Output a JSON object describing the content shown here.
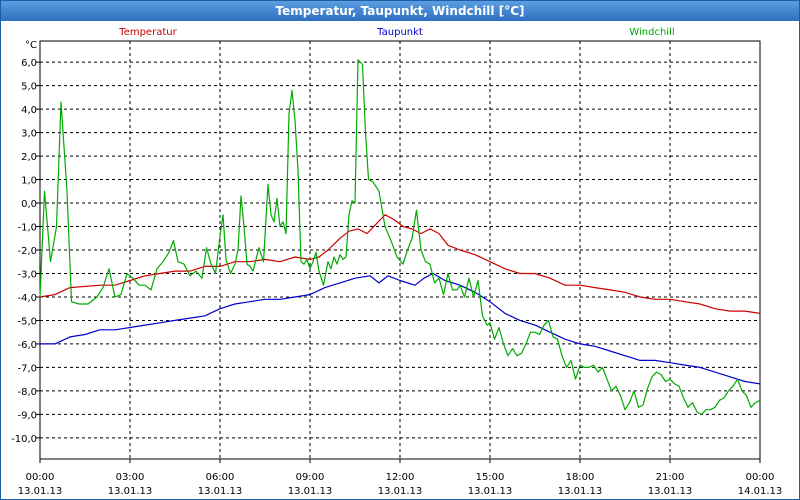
{
  "window": {
    "title": "Temperatur, Taupunkt, Windchill [°C]"
  },
  "chart_data": {
    "type": "line",
    "title": "Temperatur, Taupunkt, Windchill [°C]",
    "ylabel": "°C",
    "xlim": [
      0,
      24
    ],
    "ylim": [
      -10.9,
      6.9
    ],
    "grid": true,
    "legend": "top",
    "y_ticks": [
      "6,0",
      "5,0",
      "4,0",
      "3,0",
      "2,0",
      "1,0",
      "0,0",
      "-1,0",
      "-2,0",
      "-3,0",
      "-4,0",
      "-5,0",
      "-6,0",
      "-7,0",
      "-8,0",
      "-9,0",
      "-10,0"
    ],
    "x_ticks": [
      {
        "time": "00:00",
        "date": "13.01.13"
      },
      {
        "time": "03:00",
        "date": "13.01.13"
      },
      {
        "time": "06:00",
        "date": "13.01.13"
      },
      {
        "time": "09:00",
        "date": "13.01.13"
      },
      {
        "time": "12:00",
        "date": "13.01.13"
      },
      {
        "time": "15:00",
        "date": "13.01.13"
      },
      {
        "time": "18:00",
        "date": "13.01.13"
      },
      {
        "time": "21:00",
        "date": "13.01.13"
      },
      {
        "time": "00:00",
        "date": "14.01.13"
      }
    ],
    "series": [
      {
        "name": "Temperatur",
        "color": "#cc0000",
        "points": [
          [
            0,
            -4.0
          ],
          [
            0.5,
            -3.9
          ],
          [
            1,
            -3.6
          ],
          [
            2,
            -3.5
          ],
          [
            2.5,
            -3.5
          ],
          [
            3,
            -3.3
          ],
          [
            3.5,
            -3.1
          ],
          [
            4,
            -3.0
          ],
          [
            4.5,
            -2.9
          ],
          [
            5,
            -2.9
          ],
          [
            5.5,
            -2.7
          ],
          [
            6,
            -2.7
          ],
          [
            6.5,
            -2.5
          ],
          [
            7,
            -2.5
          ],
          [
            7.5,
            -2.4
          ],
          [
            8,
            -2.5
          ],
          [
            8.5,
            -2.3
          ],
          [
            9,
            -2.4
          ],
          [
            9.3,
            -2.3
          ],
          [
            9.6,
            -2.0
          ],
          [
            10,
            -1.5
          ],
          [
            10.3,
            -1.2
          ],
          [
            10.6,
            -1.1
          ],
          [
            10.9,
            -1.3
          ],
          [
            11.2,
            -0.9
          ],
          [
            11.5,
            -0.5
          ],
          [
            11.8,
            -0.7
          ],
          [
            12.1,
            -1.0
          ],
          [
            12.4,
            -1.1
          ],
          [
            12.7,
            -1.3
          ],
          [
            13,
            -1.1
          ],
          [
            13.3,
            -1.3
          ],
          [
            13.6,
            -1.8
          ],
          [
            14,
            -2.0
          ],
          [
            14.5,
            -2.2
          ],
          [
            15,
            -2.5
          ],
          [
            15.5,
            -2.8
          ],
          [
            16,
            -3.0
          ],
          [
            16.5,
            -3.0
          ],
          [
            17,
            -3.2
          ],
          [
            17.5,
            -3.5
          ],
          [
            18,
            -3.5
          ],
          [
            18.5,
            -3.6
          ],
          [
            19,
            -3.7
          ],
          [
            19.5,
            -3.8
          ],
          [
            20,
            -4.0
          ],
          [
            20.5,
            -4.1
          ],
          [
            21,
            -4.1
          ],
          [
            21.5,
            -4.2
          ],
          [
            22,
            -4.3
          ],
          [
            22.5,
            -4.5
          ],
          [
            23,
            -4.6
          ],
          [
            23.5,
            -4.6
          ],
          [
            24,
            -4.7
          ]
        ]
      },
      {
        "name": "Taupunkt",
        "color": "#0000cc",
        "points": [
          [
            0,
            -6.0
          ],
          [
            0.5,
            -6.0
          ],
          [
            1,
            -5.7
          ],
          [
            1.5,
            -5.6
          ],
          [
            2,
            -5.4
          ],
          [
            2.5,
            -5.4
          ],
          [
            3,
            -5.3
          ],
          [
            3.5,
            -5.2
          ],
          [
            4,
            -5.1
          ],
          [
            4.5,
            -5.0
          ],
          [
            5,
            -4.9
          ],
          [
            5.5,
            -4.8
          ],
          [
            6,
            -4.5
          ],
          [
            6.5,
            -4.3
          ],
          [
            7,
            -4.2
          ],
          [
            7.5,
            -4.1
          ],
          [
            8,
            -4.1
          ],
          [
            8.5,
            -4.0
          ],
          [
            9,
            -3.9
          ],
          [
            9.5,
            -3.6
          ],
          [
            10,
            -3.4
          ],
          [
            10.5,
            -3.2
          ],
          [
            11,
            -3.1
          ],
          [
            11.3,
            -3.4
          ],
          [
            11.6,
            -3.1
          ],
          [
            12,
            -3.3
          ],
          [
            12.5,
            -3.5
          ],
          [
            12.8,
            -3.2
          ],
          [
            13.1,
            -3.0
          ],
          [
            13.5,
            -3.3
          ],
          [
            14,
            -3.5
          ],
          [
            14.5,
            -3.8
          ],
          [
            15,
            -4.2
          ],
          [
            15.5,
            -4.7
          ],
          [
            16,
            -5.0
          ],
          [
            16.5,
            -5.2
          ],
          [
            17,
            -5.5
          ],
          [
            17.5,
            -5.8
          ],
          [
            18,
            -6.0
          ],
          [
            18.5,
            -6.1
          ],
          [
            19,
            -6.3
          ],
          [
            19.5,
            -6.5
          ],
          [
            20,
            -6.7
          ],
          [
            20.5,
            -6.7
          ],
          [
            21,
            -6.8
          ],
          [
            21.5,
            -6.9
          ],
          [
            22,
            -7.0
          ],
          [
            22.5,
            -7.2
          ],
          [
            23,
            -7.4
          ],
          [
            23.5,
            -7.6
          ],
          [
            24,
            -7.7
          ]
        ]
      },
      {
        "name": "Windchill",
        "color": "#00aa00",
        "points": [
          [
            0,
            -4.0
          ],
          [
            0.15,
            0.5
          ],
          [
            0.35,
            -2.5
          ],
          [
            0.55,
            -1.0
          ],
          [
            0.7,
            4.3
          ],
          [
            0.9,
            0.5
          ],
          [
            1.05,
            -4.2
          ],
          [
            1.3,
            -4.3
          ],
          [
            1.6,
            -4.3
          ],
          [
            1.9,
            -4.0
          ],
          [
            2.1,
            -3.6
          ],
          [
            2.3,
            -2.8
          ],
          [
            2.5,
            -4.0
          ],
          [
            2.7,
            -3.9
          ],
          [
            2.9,
            -3.0
          ],
          [
            3.1,
            -3.2
          ],
          [
            3.3,
            -3.5
          ],
          [
            3.5,
            -3.5
          ],
          [
            3.7,
            -3.7
          ],
          [
            3.9,
            -2.8
          ],
          [
            4.1,
            -2.5
          ],
          [
            4.3,
            -2.1
          ],
          [
            4.45,
            -1.6
          ],
          [
            4.6,
            -2.5
          ],
          [
            4.8,
            -2.6
          ],
          [
            5,
            -3.1
          ],
          [
            5.2,
            -2.9
          ],
          [
            5.4,
            -3.2
          ],
          [
            5.55,
            -1.9
          ],
          [
            5.7,
            -2.6
          ],
          [
            5.85,
            -3.0
          ],
          [
            6,
            -1.4
          ],
          [
            6.1,
            -0.5
          ],
          [
            6.2,
            -2.4
          ],
          [
            6.35,
            -3.0
          ],
          [
            6.5,
            -2.6
          ],
          [
            6.6,
            -2.0
          ],
          [
            6.7,
            0.3
          ],
          [
            6.8,
            -1.0
          ],
          [
            6.9,
            -2.6
          ],
          [
            7.0,
            -2.7
          ],
          [
            7.1,
            -2.9
          ],
          [
            7.3,
            -1.9
          ],
          [
            7.45,
            -2.5
          ],
          [
            7.6,
            0.8
          ],
          [
            7.7,
            -0.5
          ],
          [
            7.8,
            -0.8
          ],
          [
            7.9,
            0.2
          ],
          [
            8.0,
            -1.0
          ],
          [
            8.1,
            -0.8
          ],
          [
            8.2,
            -1.3
          ],
          [
            8.3,
            3.8
          ],
          [
            8.4,
            4.8
          ],
          [
            8.5,
            3.5
          ],
          [
            8.6,
            1.4
          ],
          [
            8.7,
            -2.5
          ],
          [
            8.8,
            -2.6
          ],
          [
            8.9,
            -2.4
          ],
          [
            9.0,
            -2.8
          ],
          [
            9.1,
            -2.5
          ],
          [
            9.2,
            -2.1
          ],
          [
            9.3,
            -2.9
          ],
          [
            9.45,
            -3.5
          ],
          [
            9.6,
            -2.5
          ],
          [
            9.7,
            -2.8
          ],
          [
            9.8,
            -2.3
          ],
          [
            9.9,
            -2.6
          ],
          [
            10.0,
            -2.2
          ],
          [
            10.1,
            -2.4
          ],
          [
            10.2,
            -2.3
          ],
          [
            10.3,
            -0.5
          ],
          [
            10.4,
            0.1
          ],
          [
            10.5,
            0.0
          ],
          [
            10.6,
            6.1
          ],
          [
            10.75,
            5.9
          ],
          [
            10.85,
            3.0
          ],
          [
            10.95,
            1.0
          ],
          [
            11.1,
            0.9
          ],
          [
            11.3,
            0.5
          ],
          [
            11.5,
            -1.0
          ],
          [
            11.7,
            -1.6
          ],
          [
            11.9,
            -2.3
          ],
          [
            12.1,
            -2.6
          ],
          [
            12.25,
            -2.0
          ],
          [
            12.4,
            -1.5
          ],
          [
            12.55,
            -0.3
          ],
          [
            12.7,
            -2.0
          ],
          [
            12.85,
            -2.5
          ],
          [
            13,
            -2.6
          ],
          [
            13.15,
            -3.4
          ],
          [
            13.3,
            -3.2
          ],
          [
            13.45,
            -3.9
          ],
          [
            13.6,
            -3.0
          ],
          [
            13.75,
            -3.7
          ],
          [
            13.9,
            -3.7
          ],
          [
            14,
            -3.5
          ],
          [
            14.15,
            -4.0
          ],
          [
            14.3,
            -3.2
          ],
          [
            14.45,
            -4.0
          ],
          [
            14.6,
            -3.3
          ],
          [
            14.75,
            -4.8
          ],
          [
            14.9,
            -5.2
          ],
          [
            15,
            -5.1
          ],
          [
            15.15,
            -5.8
          ],
          [
            15.3,
            -5.3
          ],
          [
            15.45,
            -6.0
          ],
          [
            15.6,
            -6.5
          ],
          [
            15.75,
            -6.2
          ],
          [
            15.9,
            -6.5
          ],
          [
            16.05,
            -6.4
          ],
          [
            16.2,
            -6.0
          ],
          [
            16.35,
            -5.5
          ],
          [
            16.5,
            -5.5
          ],
          [
            16.65,
            -5.6
          ],
          [
            16.8,
            -5.2
          ],
          [
            16.95,
            -5.0
          ],
          [
            17.1,
            -5.7
          ],
          [
            17.25,
            -5.8
          ],
          [
            17.4,
            -6.5
          ],
          [
            17.55,
            -7.0
          ],
          [
            17.7,
            -6.7
          ],
          [
            17.85,
            -7.5
          ],
          [
            18,
            -6.9
          ],
          [
            18.15,
            -7.0
          ],
          [
            18.3,
            -7.0
          ],
          [
            18.45,
            -6.9
          ],
          [
            18.6,
            -7.2
          ],
          [
            18.75,
            -7.0
          ],
          [
            18.9,
            -7.5
          ],
          [
            19.05,
            -8.0
          ],
          [
            19.2,
            -7.8
          ],
          [
            19.35,
            -8.2
          ],
          [
            19.5,
            -8.8
          ],
          [
            19.65,
            -8.5
          ],
          [
            19.8,
            -8.0
          ],
          [
            19.95,
            -8.7
          ],
          [
            20.1,
            -8.6
          ],
          [
            20.25,
            -7.9
          ],
          [
            20.4,
            -7.4
          ],
          [
            20.55,
            -7.2
          ],
          [
            20.7,
            -7.3
          ],
          [
            20.85,
            -7.6
          ],
          [
            21,
            -7.5
          ],
          [
            21.15,
            -7.7
          ],
          [
            21.3,
            -7.8
          ],
          [
            21.45,
            -8.3
          ],
          [
            21.6,
            -8.7
          ],
          [
            21.75,
            -8.5
          ],
          [
            21.9,
            -8.9
          ],
          [
            22.05,
            -9.0
          ],
          [
            22.2,
            -8.8
          ],
          [
            22.35,
            -8.8
          ],
          [
            22.5,
            -8.7
          ],
          [
            22.65,
            -8.4
          ],
          [
            22.8,
            -8.3
          ],
          [
            22.95,
            -8.0
          ],
          [
            23.1,
            -7.8
          ],
          [
            23.25,
            -7.5
          ],
          [
            23.4,
            -8.0
          ],
          [
            23.55,
            -8.2
          ],
          [
            23.7,
            -8.7
          ],
          [
            23.85,
            -8.5
          ],
          [
            24,
            -8.4
          ]
        ]
      }
    ]
  }
}
